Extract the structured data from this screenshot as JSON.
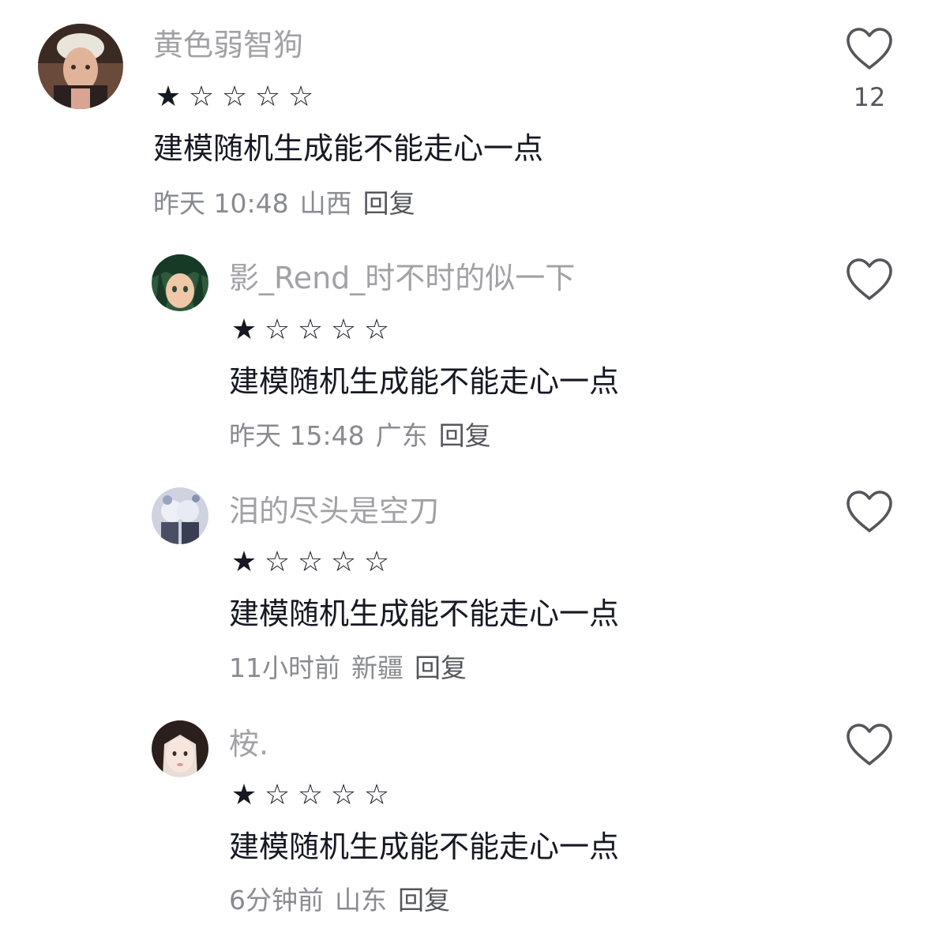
{
  "comments": [
    {
      "username": "黄色弱智狗",
      "rating": 1,
      "stars": [
        "★",
        "☆",
        "☆",
        "☆",
        "☆"
      ],
      "text": "建模随机生成能不能走心一点",
      "time": "昨天 10:48",
      "region": "山西",
      "reply_label": "回复",
      "like_count": "12",
      "avatar_icon": "avatar-user-photo"
    },
    {
      "username": "影_Rend_时不时的似一下",
      "rating": 1,
      "stars": [
        "★",
        "☆",
        "☆",
        "☆",
        "☆"
      ],
      "text": "建模随机生成能不能走心一点",
      "time": "昨天 15:48",
      "region": "广东",
      "reply_label": "回复",
      "like_count": "",
      "avatar_icon": "avatar-anime-character"
    },
    {
      "username": "泪的尽头是空刀",
      "rating": 1,
      "stars": [
        "★",
        "☆",
        "☆",
        "☆",
        "☆"
      ],
      "text": "建模随机生成能不能走心一点",
      "time": "11小时前",
      "region": "新疆",
      "reply_label": "回复",
      "like_count": "",
      "avatar_icon": "avatar-anime-pair"
    },
    {
      "username": "桉.",
      "rating": 1,
      "stars": [
        "★",
        "☆",
        "☆",
        "☆",
        "☆"
      ],
      "text": "建模随机生成能不能走心一点",
      "time": "6分钟前",
      "region": "山东",
      "reply_label": "回复",
      "like_count": "",
      "avatar_icon": "avatar-girl-photo"
    }
  ],
  "colors": {
    "username": "#a1a1a6",
    "text": "#161823",
    "meta": "#8a8b91",
    "icon": "#55565c"
  },
  "icons": {
    "like": "heart-outline-icon"
  }
}
